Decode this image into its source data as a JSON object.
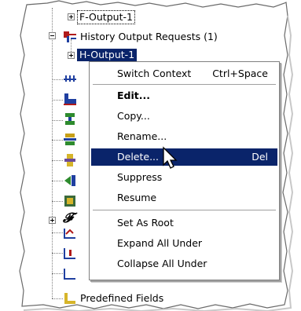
{
  "tree": {
    "nodes": [
      {
        "label": "F-Output-1",
        "icon": "field-output-icon"
      },
      {
        "label": "History Output Requests (1)",
        "icon": "history-output-requests-icon"
      },
      {
        "label": "H-Output-1",
        "icon": "history-output-icon"
      },
      {
        "label": "Predefined Fields",
        "icon": "predefined-fields-icon"
      }
    ],
    "side_icons": [
      "time-points-icon",
      "ale-adaptive-mesh-icon",
      "interactions-icon",
      "interaction-properties-icon",
      "contact-controls-icon",
      "contact-initialization-icon",
      "contact-stabilization-icon",
      "constraints-icon",
      "fields-icon",
      "connector-sections-icon",
      "amplitudes-icon",
      "loads-icon",
      "boundary-conditions-icon"
    ],
    "selected_color": "#0a246a"
  },
  "menu": {
    "items": [
      {
        "label": "Switch Context",
        "shortcut": "Ctrl+Space",
        "bold": false,
        "highlighted": false
      },
      {
        "label": "Edit...",
        "shortcut": "",
        "bold": true,
        "highlighted": false
      },
      {
        "label": "Copy...",
        "shortcut": "",
        "bold": false,
        "highlighted": false
      },
      {
        "label": "Rename...",
        "shortcut": "",
        "bold": false,
        "highlighted": false
      },
      {
        "label": "Delete...",
        "shortcut": "Del",
        "bold": false,
        "highlighted": true
      },
      {
        "label": "Suppress",
        "shortcut": "",
        "bold": false,
        "highlighted": false
      },
      {
        "label": "Resume",
        "shortcut": "",
        "bold": false,
        "highlighted": false
      },
      {
        "label": "Set As Root",
        "shortcut": "",
        "bold": false,
        "highlighted": false
      },
      {
        "label": "Expand All Under",
        "shortcut": "",
        "bold": false,
        "highlighted": false
      },
      {
        "label": "Collapse All Under",
        "shortcut": "",
        "bold": false,
        "highlighted": false
      }
    ],
    "highlight_color": "#0a246a"
  }
}
